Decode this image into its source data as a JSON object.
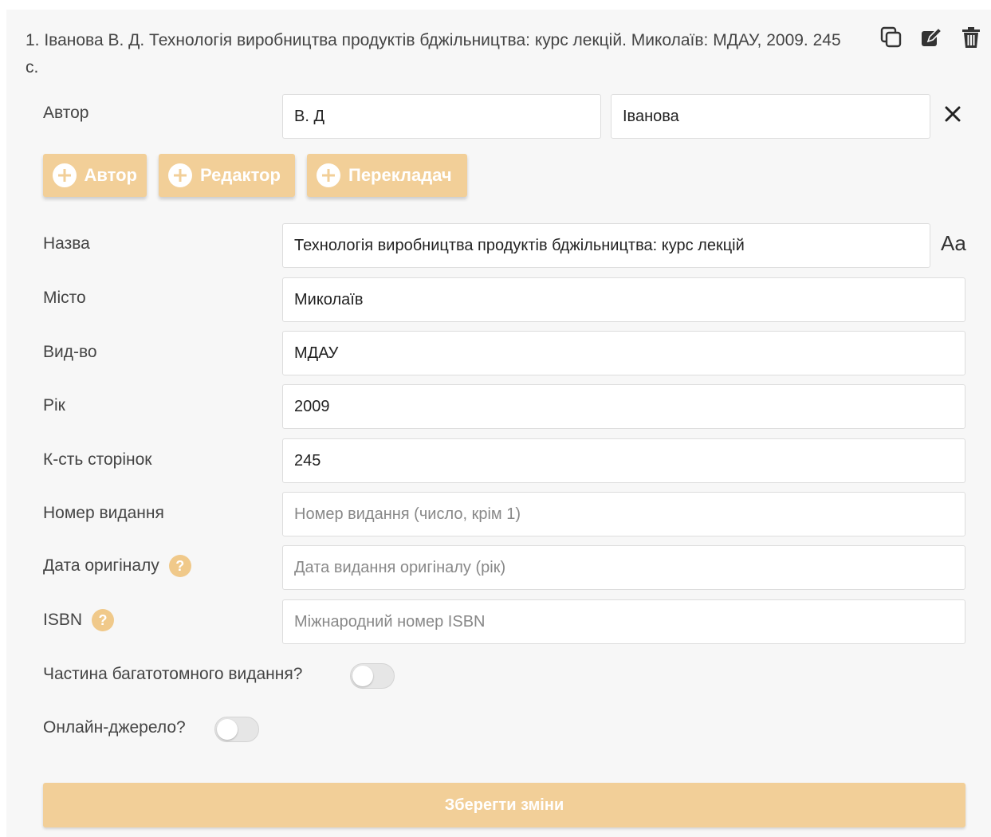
{
  "entry": {
    "citation": "1. Іванова В. Д. Технологія виробництва продуктів бджільництва: курс лекцій. Миколаїв: МДАУ, 2009. 245 с.",
    "actions": {
      "copy_icon": "copy-icon",
      "edit_icon": "edit-icon",
      "delete_icon": "trash-icon"
    }
  },
  "author": {
    "label": "Автор",
    "initials": "В. Д",
    "surname": "Іванова",
    "remove_icon": "close-icon"
  },
  "role_buttons": [
    {
      "label": "Автор"
    },
    {
      "label": "Редактор"
    },
    {
      "label": "Перекладач"
    }
  ],
  "fields": {
    "title": {
      "label": "Назва",
      "value": "Технологія виробництва продуктів бджільництва: курс лекцій",
      "case_toggle": "Aa"
    },
    "city": {
      "label": "Місто",
      "value": "Миколаїв"
    },
    "publisher": {
      "label": "Вид-во",
      "value": "МДАУ"
    },
    "year": {
      "label": "Рік",
      "value": "2009"
    },
    "pages": {
      "label": "К-сть сторінок",
      "value": "245"
    },
    "edition": {
      "label": "Номер видання",
      "value": "",
      "placeholder": "Номер видання (число, крім 1)"
    },
    "original_date": {
      "label": "Дата оригіналу",
      "value": "",
      "placeholder": "Дата видання оригіналу (рік)",
      "help": "?"
    },
    "isbn": {
      "label": "ISBN",
      "value": "",
      "placeholder": "Міжнародний номер ISBN",
      "help": "?"
    }
  },
  "toggles": {
    "multivolume": {
      "label": "Частина багатотомного видання?",
      "on": false
    },
    "online": {
      "label": "Онлайн-джерело?",
      "on": false
    }
  },
  "save_label": "Зберегти зміни",
  "colors": {
    "accent": "#f2cf98",
    "help": "#f0c98a",
    "panel": "#f7f7f7"
  }
}
